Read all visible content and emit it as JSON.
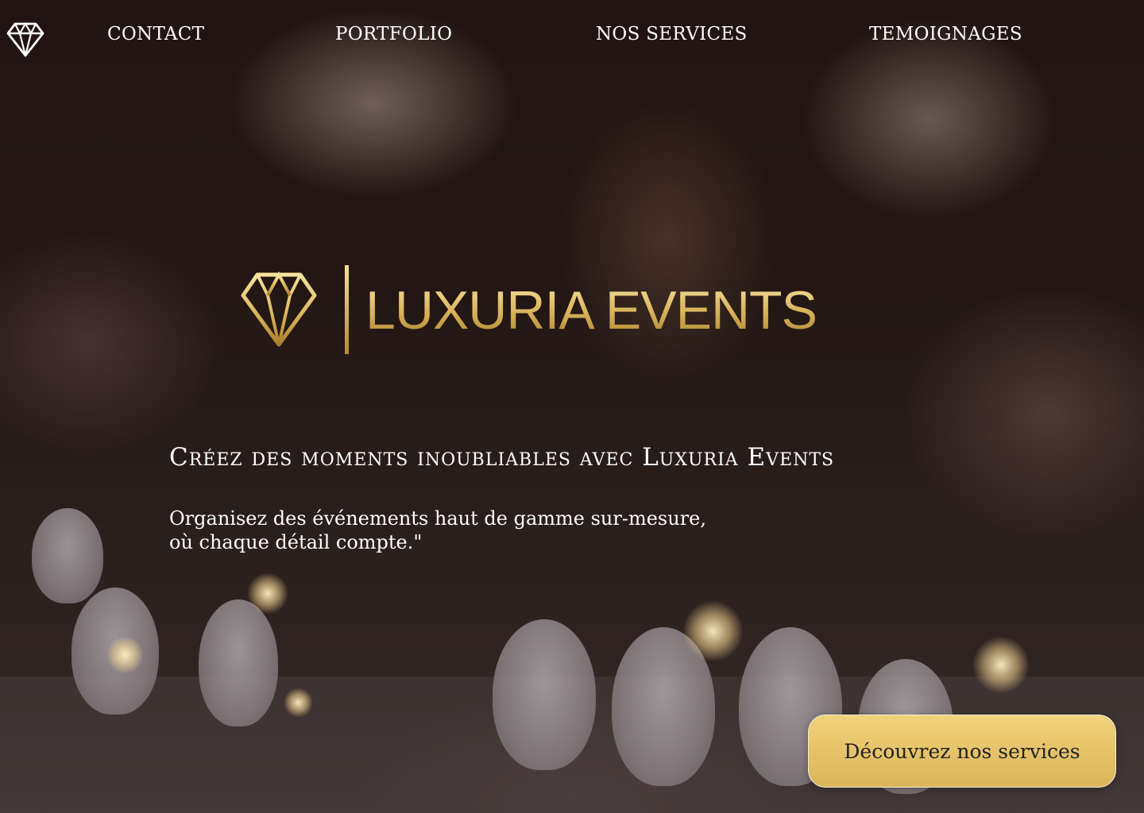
{
  "nav": {
    "logo_icon": "diamond-icon",
    "links": [
      {
        "label": "CONTACT"
      },
      {
        "label": "PORTFOLIO"
      },
      {
        "label": "NOS SERVICES"
      },
      {
        "label": "TEMOIGNAGES"
      }
    ]
  },
  "hero": {
    "brand_icon": "diamond-icon",
    "brand_name": "Luxuria Events",
    "headline": "Créez des moments inoubliables avec Luxuria Events",
    "subtext_line1": "Organisez des événements haut de gamme sur-mesure,",
    "subtext_line2": "où chaque détail compte.\"",
    "cta_label": "Découvrez nos services"
  },
  "colors": {
    "gold": "#e2c36a",
    "cta_background": "#e6c369",
    "text": "#ffffff"
  }
}
